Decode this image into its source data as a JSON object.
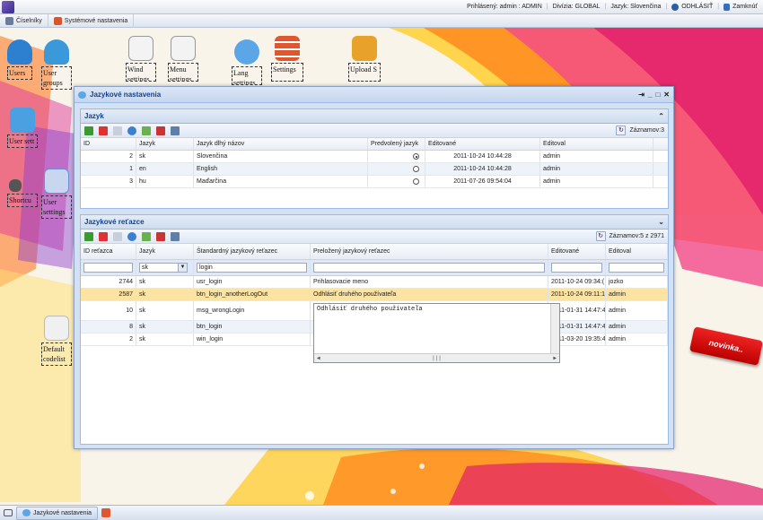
{
  "top": {
    "logged_in": "Prihlásený: admin : ADMIN",
    "division": "Divízia: GLOBAL",
    "language": "Jazyk: Slovenčina",
    "logout": "ODHLÁSIŤ",
    "lock": "Zamknúť"
  },
  "menu": [
    {
      "label": "Číselníky"
    },
    {
      "label": "Systémové nastavenia"
    }
  ],
  "desktop": [
    {
      "label": "Users",
      "icon": "users-icon",
      "color": "#2d7fd0"
    },
    {
      "label": "User groups",
      "icon": "user-groups-icon",
      "color": "#3a9ad9"
    },
    {
      "label": "User sett",
      "icon": "user-settings-icon",
      "color": "#4aa0e0"
    },
    {
      "label": "Shortcu",
      "icon": "shortcut-icon",
      "color": "#555555"
    },
    {
      "label": "User settings",
      "icon": "user-settings-doc-icon",
      "color": "#6b8fd6"
    },
    {
      "label": "Default codelist",
      "icon": "codelist-icon",
      "color": "#d8d8d8"
    },
    {
      "label": "Wind settings",
      "icon": "window-settings-icon",
      "color": "#cccccc"
    },
    {
      "label": "Menu settings",
      "icon": "menu-settings-icon",
      "color": "#cccccc"
    },
    {
      "label": "Lang settings",
      "icon": "language-icon",
      "color": "#5aa6e6"
    },
    {
      "label": "Settings",
      "icon": "settings-icon",
      "color": "#e0562e"
    },
    {
      "label": "Upload S",
      "icon": "upload-icon",
      "color": "#e8a12a"
    }
  ],
  "window": {
    "title": "Jazykové nastavenia"
  },
  "lang_panel": {
    "title": "Jazyk",
    "count": "Záznamov:3",
    "columns": [
      "ID",
      "Jazyk",
      "Jazyk dlhý názov",
      "Predvolený jazyk",
      "Editované",
      "Editoval"
    ],
    "rows": [
      {
        "id": "2",
        "code": "sk",
        "name": "Slovenčina",
        "default": true,
        "edited": "2011-10-24 10:44:28",
        "by": "admin"
      },
      {
        "id": "1",
        "code": "en",
        "name": "English",
        "default": false,
        "edited": "2011-10-24 10:44:28",
        "by": "admin"
      },
      {
        "id": "3",
        "code": "hu",
        "name": "Maďarčina",
        "default": false,
        "edited": "2011-07-26 09:54:04",
        "by": "admin"
      }
    ]
  },
  "str_panel": {
    "title": "Jazykové reťazce",
    "count": "Záznamov:5 z 2971",
    "columns": [
      "ID reťazca",
      "Jazyk",
      "Štandardný jazykový reťazec",
      "Preložený jazykový reťazec",
      "Editované",
      "Editoval"
    ],
    "filter": {
      "lang": "sk",
      "std": "login"
    },
    "rows": [
      {
        "id": "2744",
        "code": "sk",
        "std": "usr_login",
        "tr": "Prihlasovacie meno",
        "edited": "2011-10-24 09:34:(",
        "by": "jozko"
      },
      {
        "id": "2587",
        "code": "sk",
        "std": "btn_login_anotherLogOut",
        "tr": "Odhlásiť druhého používateľa",
        "edited": "2011-10-24 09:11:1",
        "by": "admin"
      },
      {
        "id": "10",
        "code": "sk",
        "std": "msg_wrongLogin",
        "tr": "",
        "edited": "2011-01-31 14:47:4",
        "by": "admin"
      },
      {
        "id": "8",
        "code": "sk",
        "std": "btn_login",
        "tr": "",
        "edited": "2011-01-31 14:47:4",
        "by": "admin"
      },
      {
        "id": "2",
        "code": "sk",
        "std": "win_login",
        "tr": "",
        "edited": "2011-03-20 19:35:4",
        "by": "admin"
      }
    ],
    "editor_text": "Odhlásiť druhého používateľa"
  },
  "taskbar": {
    "item": "Jazykové nastavenia"
  },
  "badge": "novinka.."
}
